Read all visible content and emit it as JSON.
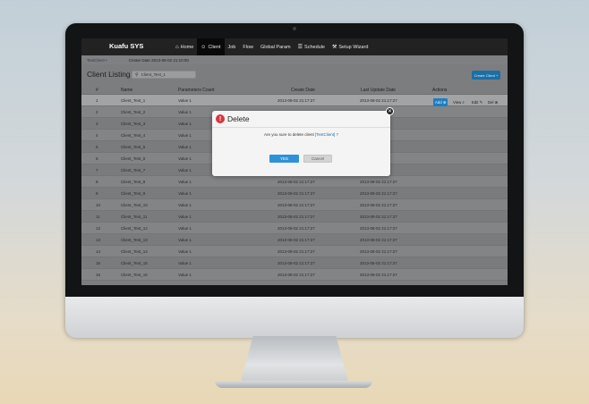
{
  "nav": {
    "brand": "Kuafu SYS",
    "items": [
      {
        "label": "Home",
        "icon": "home-icon",
        "glyph": "⌂"
      },
      {
        "label": "Client",
        "icon": "user-icon",
        "glyph": "☺"
      },
      {
        "label": "Job",
        "icon": "",
        "glyph": ""
      },
      {
        "label": "Flow",
        "icon": "",
        "glyph": ""
      },
      {
        "label": "Global Param",
        "icon": "",
        "glyph": ""
      },
      {
        "label": "Schedule",
        "icon": "list-icon",
        "glyph": "☰"
      },
      {
        "label": "Setup Wizard",
        "icon": "wrench-icon",
        "glyph": "⚒"
      }
    ]
  },
  "subheader": {
    "breadcrumb": "TestClient •",
    "created": "Create Date 2013-08-02 21:10:00"
  },
  "listing": {
    "title": "Client Listing",
    "search_value": "Client_Test_1",
    "create_button": "Create Client +"
  },
  "table": {
    "columns": [
      "#",
      "Name",
      "Parameters Count",
      "Create Date",
      "Last Update Date",
      "Actions"
    ],
    "actions": {
      "add": "Add ⊕",
      "view": "View ⌕",
      "edit": "Edit ✎",
      "del": "Del ⊗"
    },
    "rows": [
      {
        "num": "1",
        "name": "Client_Test_1",
        "param": "Value 1",
        "created": "2013-08-02 21:17:27",
        "updated": "2013-08-02 21:17:27"
      },
      {
        "num": "2",
        "name": "Client_Test_2",
        "param": "Value 1",
        "created": "",
        "updated": ""
      },
      {
        "num": "3",
        "name": "Client_Test_3",
        "param": "Value 1",
        "created": "",
        "updated": ""
      },
      {
        "num": "4",
        "name": "Client_Test_4",
        "param": "Value 1",
        "created": "",
        "updated": ""
      },
      {
        "num": "5",
        "name": "Client_Test_5",
        "param": "Value 1",
        "created": "",
        "updated": ""
      },
      {
        "num": "6",
        "name": "Client_Test_6",
        "param": "Value 1",
        "created": "",
        "updated": ""
      },
      {
        "num": "7",
        "name": "Client_Test_7",
        "param": "Value 1",
        "created": "",
        "updated": ""
      },
      {
        "num": "8",
        "name": "Client_Test_8",
        "param": "Value 1",
        "created": "2013-08-02 21:17:27",
        "updated": "2013-08-02 21:17:27"
      },
      {
        "num": "9",
        "name": "Client_Test_9",
        "param": "Value 1",
        "created": "2013-08-02 21:17:27",
        "updated": "2013-08-02 21:17:27"
      },
      {
        "num": "10",
        "name": "Client_Test_10",
        "param": "Value 1",
        "created": "2013-08-02 21:17:27",
        "updated": "2013-08-02 21:17:27"
      },
      {
        "num": "11",
        "name": "Client_Test_11",
        "param": "Value 1",
        "created": "2013-08-02 21:17:27",
        "updated": "2013-08-02 21:17:27"
      },
      {
        "num": "12",
        "name": "Client_Test_12",
        "param": "Value 1",
        "created": "2013-08-02 21:17:27",
        "updated": "2013-08-02 21:17:27"
      },
      {
        "num": "13",
        "name": "Client_Test_13",
        "param": "Value 1",
        "created": "2013-08-02 21:17:27",
        "updated": "2013-08-02 21:17:27"
      },
      {
        "num": "14",
        "name": "Client_Test_14",
        "param": "Value 1",
        "created": "2013-08-02 21:17:27",
        "updated": "2013-08-02 21:17:27"
      },
      {
        "num": "15",
        "name": "Client_Test_15",
        "param": "Value 1",
        "created": "2013-08-02 21:17:27",
        "updated": "2013-08-02 21:17:27"
      },
      {
        "num": "16",
        "name": "Client_Test_16",
        "param": "Value 1",
        "created": "2013-08-02 21:17:27",
        "updated": "2013-08-02 21:17:27"
      }
    ]
  },
  "modal": {
    "title": "Delete",
    "warn_glyph": "!",
    "close_glyph": "✕",
    "message_pre": "Are you sure to delete client",
    "message_target": "[TestClient]",
    "message_post": "?",
    "yes_label": "YES",
    "cancel_label": "Cancel"
  }
}
